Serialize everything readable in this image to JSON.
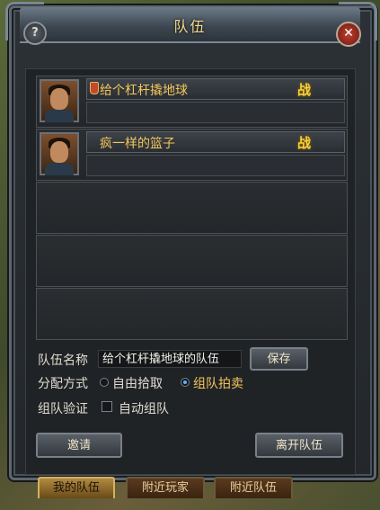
{
  "window": {
    "title": "队伍"
  },
  "members": [
    {
      "name": "给个杠杆撬地球",
      "badge": "战",
      "leader": true
    },
    {
      "name": "疯一样的篮子",
      "badge": "战",
      "leader": false
    }
  ],
  "form": {
    "team_name_label": "队伍名称",
    "team_name_value": "给个杠杆撬地球的队伍",
    "save_label": "保存",
    "distribution_label": "分配方式",
    "distribution_options": [
      "自由拾取",
      "组队拍卖"
    ],
    "distribution_selected": "组队拍卖",
    "verify_label": "组队验证",
    "auto_team_label": "自动组队",
    "auto_team_checked": false
  },
  "actions": {
    "invite_label": "邀请",
    "leave_label": "离开队伍"
  },
  "tabs": [
    {
      "label": "我的队伍",
      "active": true
    },
    {
      "label": "附近玩家",
      "active": false
    },
    {
      "label": "附近队伍",
      "active": false
    }
  ],
  "colors": {
    "name_text": "#f3c55a",
    "title_text": "#f3d98a",
    "badge_text": "#f5d23a"
  }
}
